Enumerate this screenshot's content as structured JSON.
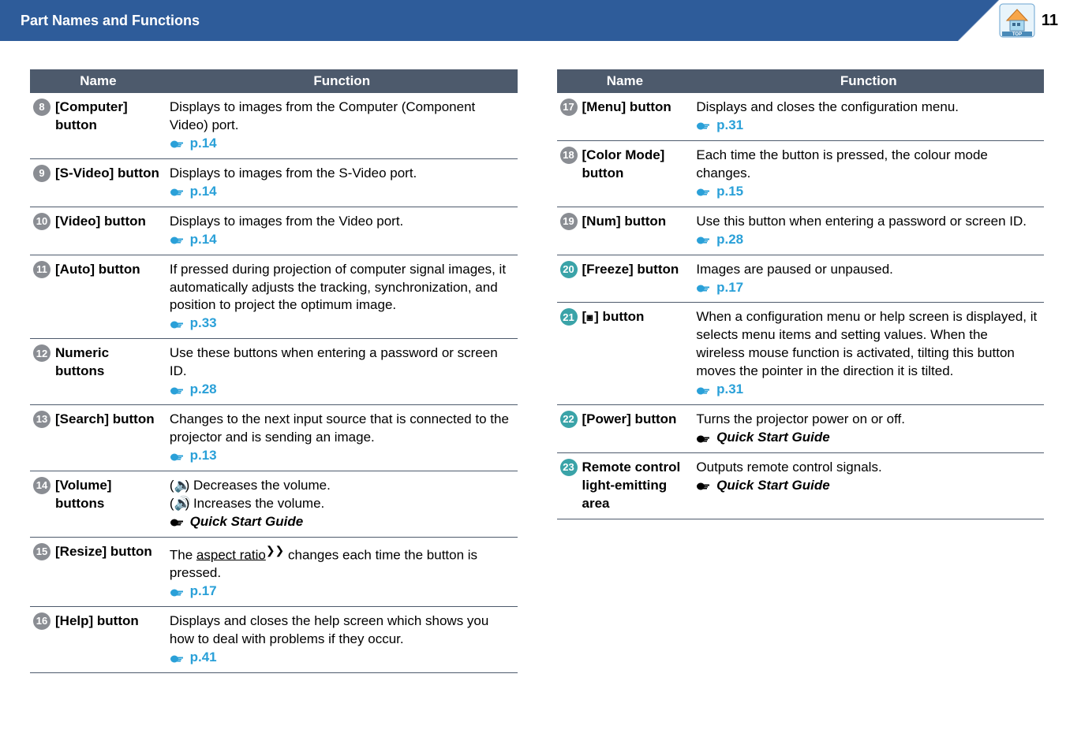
{
  "header": {
    "title": "Part Names and Functions",
    "page_number": "11"
  },
  "table_headers": {
    "name": "Name",
    "function": "Function"
  },
  "left_rows": [
    {
      "num": "8",
      "color": "gray",
      "name": "[Computer] button",
      "desc": "Displays to images from the Computer (Component Video) port.",
      "link": "p.14",
      "link_type": "page"
    },
    {
      "num": "9",
      "color": "gray",
      "name": "[S-Video] button",
      "desc": "Displays to images from the S-Video port.",
      "link": "p.14",
      "link_type": "page"
    },
    {
      "num": "10",
      "color": "gray",
      "name": "[Video] button",
      "desc": "Displays to images from the Video port.",
      "link": "p.14",
      "link_type": "page"
    },
    {
      "num": "11",
      "color": "gray",
      "name": "[Auto] button",
      "desc": "If pressed during projection of computer signal images, it automatically adjusts the tracking, synchronization, and position to project the optimum image.",
      "link": "p.33",
      "link_type": "page"
    },
    {
      "num": "12",
      "color": "gray",
      "name": "Numeric buttons",
      "desc": "Use these buttons when entering a password or screen ID.",
      "link": "p.28",
      "link_type": "page"
    },
    {
      "num": "13",
      "color": "gray",
      "name": "[Search] button",
      "desc": "Changes to the next input source that is connected to the projector and is sending an image.",
      "link": "p.13",
      "link_type": "page"
    },
    {
      "num": "14",
      "color": "gray",
      "name": "[Volume] buttons",
      "desc_vol_dec": "Decreases the volume.",
      "desc_vol_inc": "Increases the volume.",
      "link": "Quick Start Guide",
      "link_type": "guide",
      "special": "volume"
    },
    {
      "num": "15",
      "color": "gray",
      "name": "[Resize] button",
      "desc_pre": "The ",
      "glossary": "aspect ratio",
      "desc_post": " changes each time the button is pressed.",
      "link": "p.17",
      "link_type": "page",
      "special": "resize"
    },
    {
      "num": "16",
      "color": "gray",
      "name": "[Help] button",
      "desc": "Displays and closes the help screen which shows you how to deal with problems if they occur.",
      "link": "p.41",
      "link_type": "page"
    }
  ],
  "right_rows": [
    {
      "num": "17",
      "color": "gray",
      "name": "[Menu] button",
      "desc": "Displays and closes the configuration menu.",
      "link": "p.31",
      "link_type": "page"
    },
    {
      "num": "18",
      "color": "gray",
      "name": "[Color Mode] button",
      "desc": "Each time the button is pressed, the colour mode changes.",
      "link": "p.15",
      "link_type": "page"
    },
    {
      "num": "19",
      "color": "gray",
      "name": "[Num] button",
      "desc": "Use this button when entering a password or screen ID.",
      "link": "p.28",
      "link_type": "page"
    },
    {
      "num": "20",
      "color": "teal",
      "name": "[Freeze] button",
      "desc": "Images are paused or unpaused.",
      "link": "p.17",
      "link_type": "page"
    },
    {
      "num": "21",
      "color": "teal",
      "name_nav": true,
      "name_pre": "[",
      "name_post": "] button",
      "desc": "When a configuration menu or help screen is displayed, it selects menu items and setting values.  When the wireless mouse function is activated, tilting this button moves the pointer in the direction it is tilted.",
      "link": "p.31",
      "link_type": "page"
    },
    {
      "num": "22",
      "color": "teal",
      "name": "[Power] button",
      "desc": "Turns the projector power on or off.",
      "link": "Quick Start Guide",
      "link_type": "guide"
    },
    {
      "num": "23",
      "color": "teal",
      "name": "Remote control light-emitting area",
      "desc": "Outputs remote control signals.",
      "link": "Quick Start Guide",
      "link_type": "guide"
    }
  ]
}
